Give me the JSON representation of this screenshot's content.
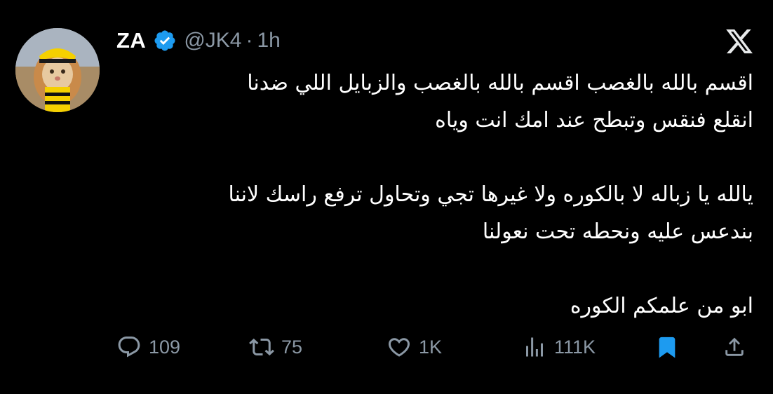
{
  "author": {
    "display_name": "ZA",
    "handle": "@JK4",
    "separator": "·",
    "time": "1h",
    "verified": true,
    "avatar_icon": "lion-avatar-icon"
  },
  "platform_icon": "x-logo-icon",
  "tweet": {
    "lines": [
      "اقسم بالله بالغصب اقسم بالله بالغصب والزبايل اللي ضدنا",
      "انقلع فنقس وتبطح عند امك انت وياه",
      "",
      "يالله يا زباله لا بالكوره ولا غيرها تجي وتحاول ترفع راسك لاننا",
      "بندعس عليه ونحطه تحت نعولنا",
      "",
      "ابو من علمكم الكوره"
    ]
  },
  "actions": {
    "reply": {
      "icon": "reply-icon",
      "count": "109"
    },
    "repost": {
      "icon": "repost-icon",
      "count": "75"
    },
    "like": {
      "icon": "heart-icon",
      "count": "1K"
    },
    "views": {
      "icon": "views-icon",
      "count": "111K"
    },
    "bookmark": {
      "icon": "bookmark-icon",
      "active": true
    },
    "share": {
      "icon": "share-icon"
    }
  },
  "colors": {
    "background": "#000000",
    "text": "#ffffff",
    "secondary": "#8b98a5",
    "verified": "#1d9bf0",
    "bookmark_active": "#1d9bf0"
  }
}
